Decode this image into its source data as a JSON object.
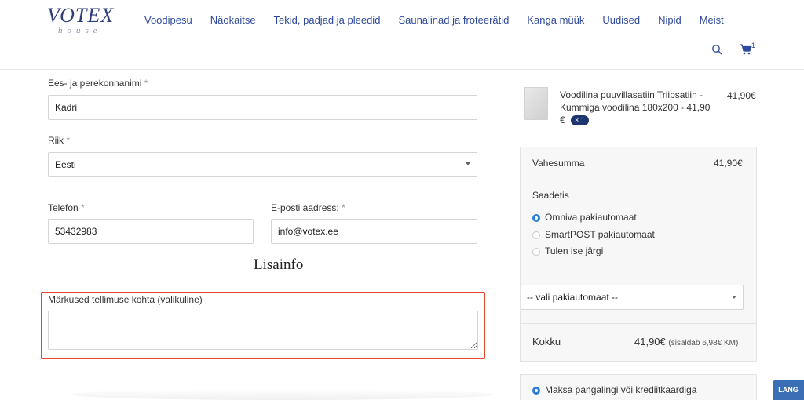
{
  "header": {
    "logo_main": "VOTEX",
    "logo_sub": "house",
    "nav": [
      "Voodipesu",
      "Näokaitse",
      "Tekid, padjad ja pleedid",
      "Saunalinad ja froteerätid",
      "Kanga müük",
      "Uudised",
      "Nipid",
      "Meist"
    ],
    "cart_count": "1"
  },
  "form": {
    "name_label": "Ees- ja perekonnanimi",
    "name_value": "Kadri",
    "country_label": "Riik",
    "country_value": "Eesti",
    "phone_label": "Telefon",
    "phone_value": "53432983",
    "email_label": "E-posti aadress:",
    "email_value": "info@votex.ee",
    "required_mark": "*",
    "section_title": "Lisainfo",
    "notes_label": "Märkused tellimuse kohta (valikuline)",
    "notes_value": ""
  },
  "order": {
    "product_line1": "Voodilina puuvillasatiin Triipsatiin -",
    "product_line2": "Kummiga voodilina 180x200 - 41,90",
    "product_line3": "€",
    "product_qty": "× 1",
    "product_price": "41,90€",
    "subtotal_label": "Vahesumma",
    "subtotal_value": "41,90€",
    "shipping_label": "Saadetis",
    "shipping_options": [
      {
        "label": "Omniva pakiautomaat",
        "checked": true
      },
      {
        "label": "SmartPOST pakiautomaat",
        "checked": false
      },
      {
        "label": "Tulen ise järgi",
        "checked": false
      }
    ],
    "parcel_select": "-- vali pakiautomaat --",
    "total_label": "Kokku",
    "total_value": "41,90€",
    "total_note": "(sisaldab 6,98€ KM)",
    "payment_option": "Maksa pangalingi või krediitkaardiga"
  },
  "lang_button": "LANG",
  "colors": {
    "nav": "#2f4a9a",
    "highlight": "#e5432c",
    "badge": "#1d3670",
    "radio": "#2b7fd8",
    "lang": "#3a6fb5"
  }
}
